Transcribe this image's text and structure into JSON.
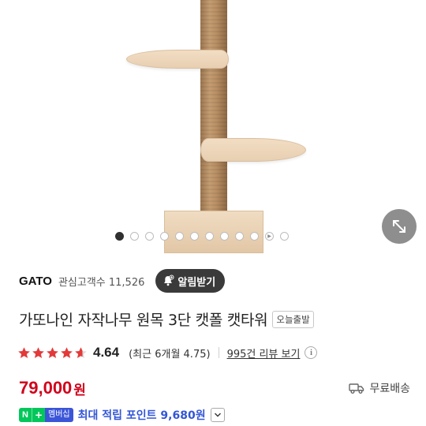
{
  "store": {
    "name": "GATO",
    "followers_label": "관심고객수 11,526",
    "follow_button": "알림받기"
  },
  "product": {
    "title": "가또나인 자작나무 원목 3단 캣폴 캣타워",
    "badge": "오늘출발"
  },
  "rating": {
    "score": "4.64",
    "recent": "(최근 6개월 4.75)",
    "reviews_link": "995건 리뷰 보기",
    "stars_filled": 4.64,
    "stars_total": 5
  },
  "price": {
    "amount": "79,000",
    "unit": "원"
  },
  "shipping": {
    "label": "무료배송"
  },
  "points": {
    "npay_n": "N",
    "npay_plus": "+",
    "npay_member": "멤버십",
    "text": "최대 적립 포인트 9,680원"
  },
  "gallery": {
    "total_slides": 12,
    "active_index": 1
  },
  "colors": {
    "price": "#d0021b",
    "points": "#3356d6",
    "star": "#e23a3a",
    "npay_green": "#03c75a"
  },
  "icons": {
    "expand": "expand-arrows-icon",
    "bell": "bell-icon",
    "info": "info-icon",
    "truck": "truck-icon",
    "chevron": "chevron-down-icon"
  }
}
